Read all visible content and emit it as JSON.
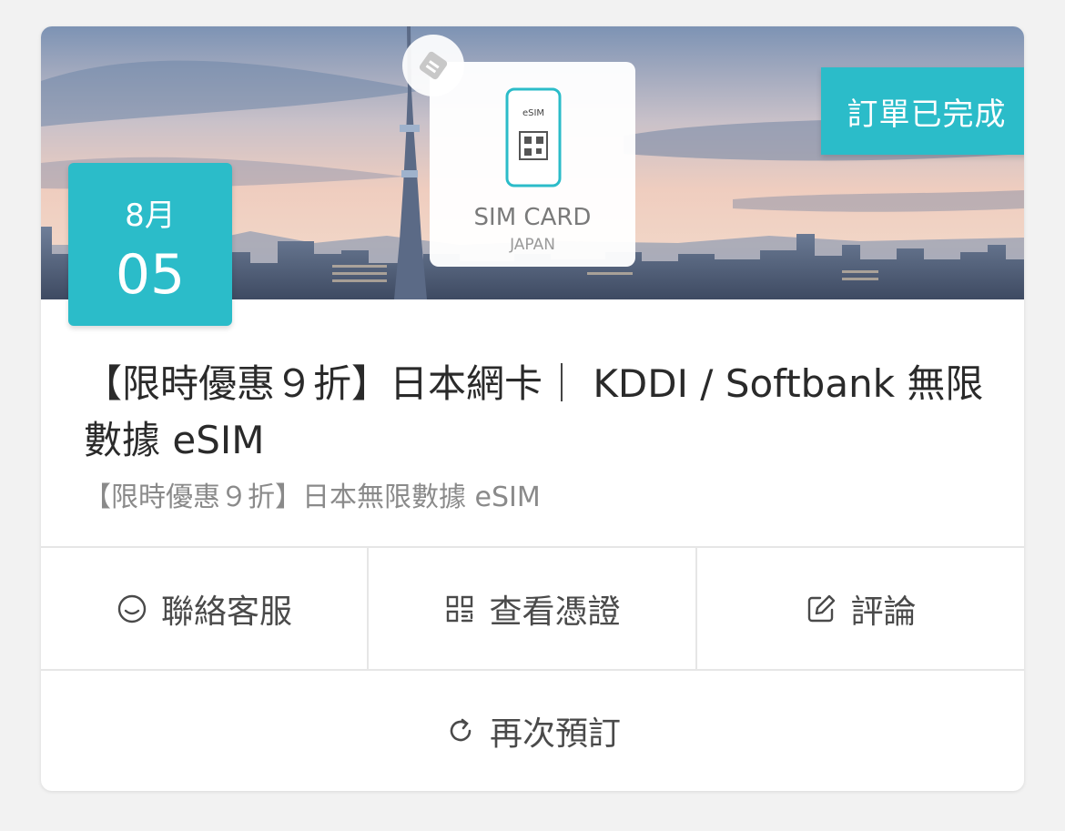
{
  "order": {
    "status": "訂單已完成",
    "date_month": "8月",
    "date_day": "05",
    "title": "【限時優惠９折】日本網卡｜ KDDI / Softbank 無限數據 eSIM",
    "subtitle": "【限時優惠９折】日本無限數據 eSIM",
    "product_card": {
      "esim_label": "eSIM",
      "main_label": "SIM CARD",
      "sub_label": "JAPAN"
    }
  },
  "actions": {
    "contact_label": "聯絡客服",
    "voucher_label": "查看憑證",
    "review_label": "評論",
    "rebook_label": "再次預訂"
  },
  "icons": [
    "tag-icon",
    "chat-icon",
    "qr-code-icon",
    "edit-icon",
    "refresh-icon"
  ],
  "colors": {
    "accent": "#2bbcc9",
    "title_text": "#2a2a2a",
    "subtitle_text": "#8a8a8a",
    "action_text": "#4a4a4a"
  }
}
